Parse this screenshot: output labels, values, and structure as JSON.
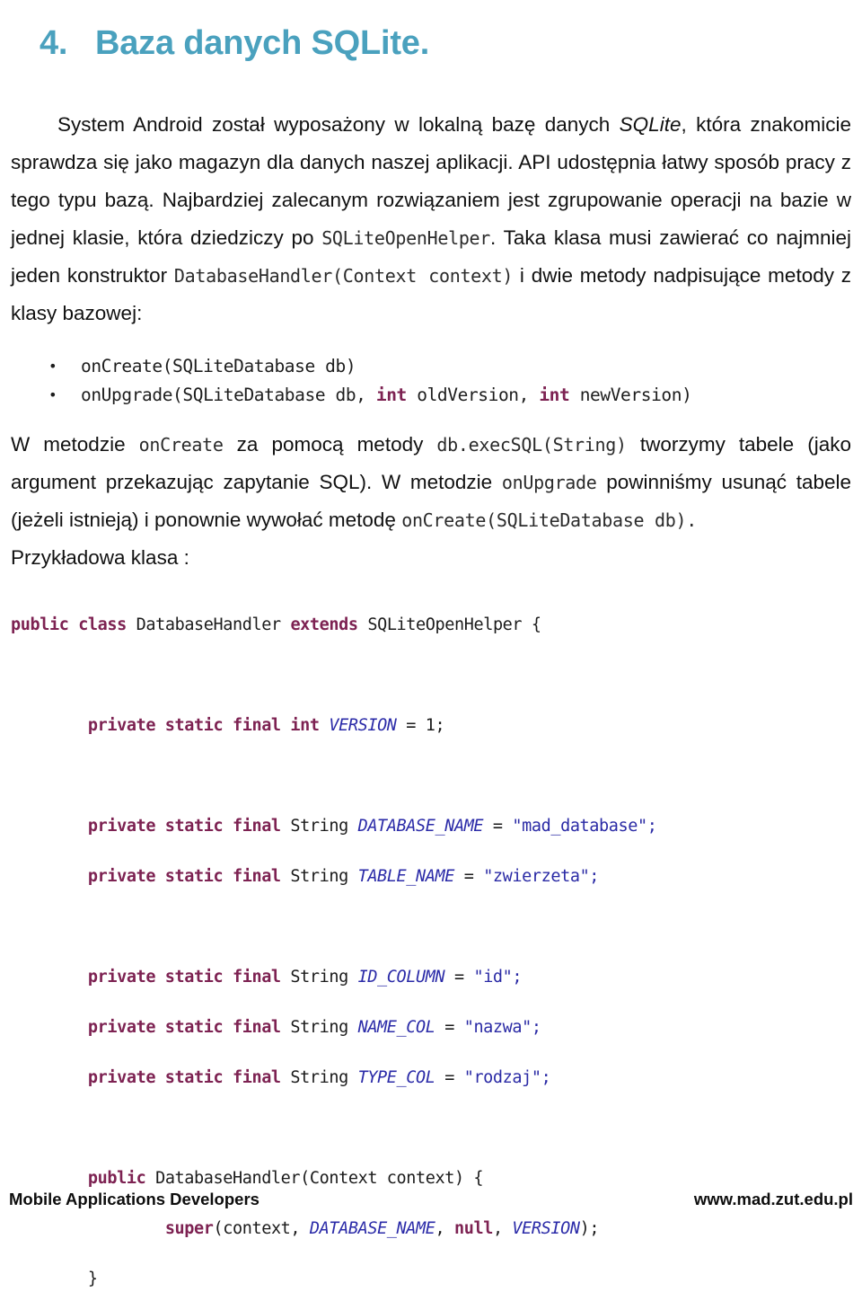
{
  "title": {
    "number": "4.",
    "text": "Baza danych SQLite."
  },
  "paragraphs": {
    "p1_a": "System Android został wyposażony w lokalną bazę danych ",
    "p1_sqlite": "SQLite",
    "p1_b": ", która znakomicie sprawdza się jako magazyn dla danych naszej aplikacji. API udostępnia łatwy sposób pracy z tego typu bazą. Najbardziej zalecanym rozwiązaniem jest zgrupowanie operacji na bazie w jednej klasie, która dziedziczy po ",
    "p1_code1": "SQLiteOpenHelper",
    "p1_c": ". Taka klasa musi zawierać co najmniej jeden konstruktor ",
    "p1_code2": "DatabaseHandler(Context context)",
    "p1_d": " i dwie metody nadpisujące metody z klasy bazowej:",
    "p2_a": "W metodzie ",
    "p2_code1": "onCreate",
    "p2_b": " za pomocą metody ",
    "p2_code2": "db.execSQL(String)",
    "p2_c": " tworzymy tabele (jako argument przekazując zapytanie SQL). W metodzie ",
    "p2_code3": "onUpgrade",
    "p2_d": " powinniśmy usunąć tabele (jeżeli istnieją) i ponownie wywołać metodę ",
    "p2_code4": "onCreate(SQLiteDatabase db)",
    "p2_e": "."
  },
  "bullets": [
    {
      "marker": "•",
      "text": "onCreate(SQLiteDatabase db)"
    },
    {
      "marker": "•",
      "text": "onUpgrade(SQLiteDatabase db, int oldVersion, int newVersion)"
    }
  ],
  "bullet2_parts": {
    "a": "onUpgrade(SQLiteDatabase db, ",
    "kw1": "int",
    "b": " oldVersion, ",
    "kw2": "int",
    "c": " newVersion)"
  },
  "example_label": "Przykładowa klasa :",
  "code": {
    "line_class_a": "public class ",
    "line_class_kw1": "public",
    "line_class_kw2": "class",
    "line_class_name": " DatabaseHandler ",
    "line_class_kw3": "extends",
    "line_class_super": " SQLiteOpenHelper {",
    "version_kws": "private static final int",
    "version_id": "VERSION",
    "version_assign": " = ",
    "version_val": "1;",
    "dbname_kws": "private static final",
    "dbname_type": " String ",
    "dbname_id": "DATABASE_NAME",
    "dbname_assign": " = ",
    "dbname_val": "\"mad_database\";",
    "tablename_id": "TABLE_NAME",
    "tablename_val": "\"zwierzeta\";",
    "idcol_id": "ID_COLUMN",
    "idcol_val": "\"id\";",
    "namecol_id": "NAME_COL",
    "namecol_val": "\"nazwa\";",
    "typecol_id": "TYPE_COL",
    "typecol_val": "\"rodzaj\";",
    "ctor_kw": "public",
    "ctor_sig": " DatabaseHandler(Context context) {",
    "super_kw": "super",
    "super_a": "(context, ",
    "super_id1": "DATABASE_NAME",
    "super_b": ", ",
    "super_kw2": "null",
    "super_c": ", ",
    "super_id2": "VERSION",
    "super_d": ");",
    "closing_brace": "}"
  },
  "footer": {
    "left": "Mobile Applications Developers",
    "right": "www.mad.zut.edu.pl"
  },
  "colors": {
    "title": "#4AA1BE",
    "keyword": "#7D2252",
    "identifier": "#2B2BA8",
    "string": "#2A2AA5",
    "body_text": "#111111"
  }
}
